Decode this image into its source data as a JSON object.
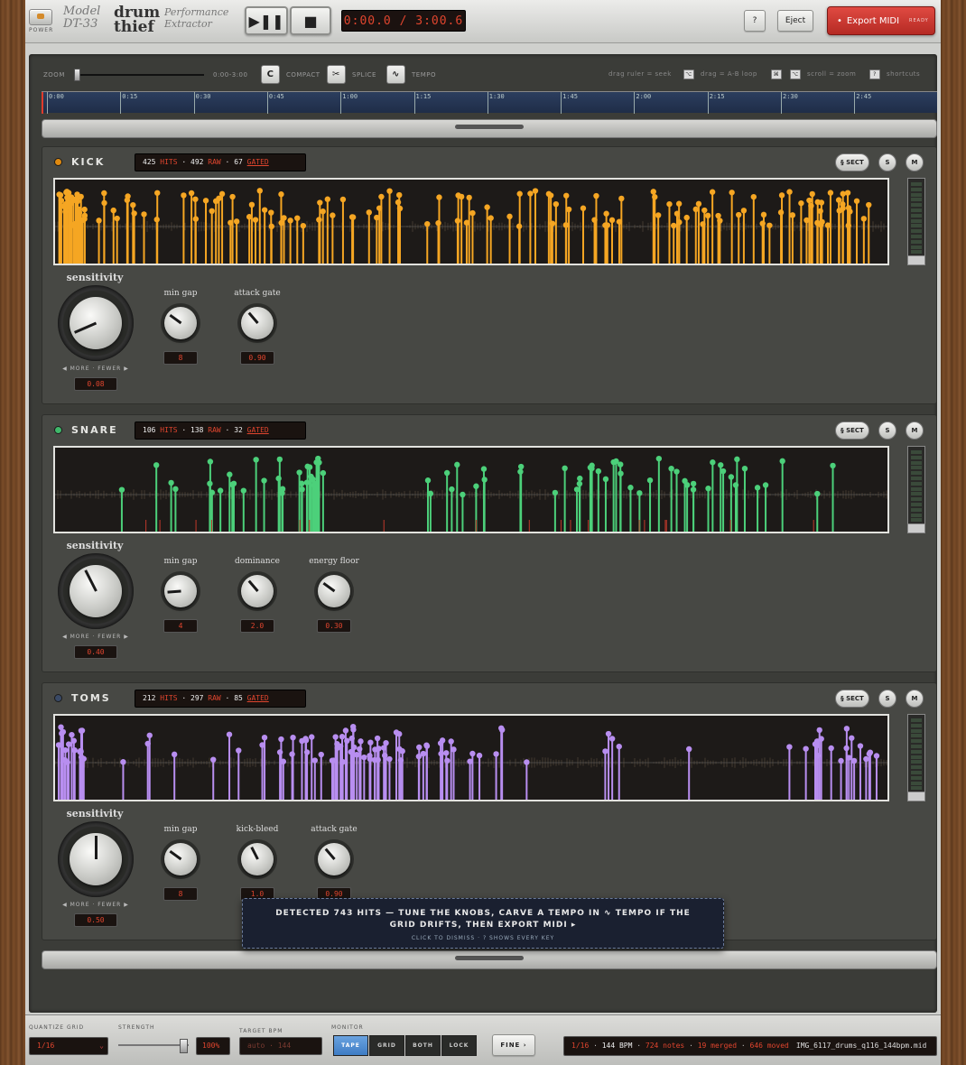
{
  "header": {
    "power_label": "POWER",
    "brand_model_line1": "Model",
    "brand_model_line2": "DT-33",
    "brand_name_line1": "drum",
    "brand_name_line2": "thief",
    "brand_sub_line1": "Performance",
    "brand_sub_line2": "Extractor",
    "time_display": "0:00.0 / 3:00.6",
    "help_label": "?",
    "eject_label": "Eject",
    "export_label": "Export MIDI",
    "export_status": "READY"
  },
  "controls": {
    "zoom_label": "ZOOM",
    "zoom_range": "0:00-3:00",
    "compact_icon_text": "C",
    "compact_label": "COMPACT",
    "splice_label": "SPLICE",
    "tempo_label": "TEMPO",
    "hint_seek": "drag ruler = seek",
    "hint_loop_key": "⌥",
    "hint_loop": "drag = A-B loop",
    "hint_zoom_key1": "⌘",
    "hint_zoom_key2": "⌥",
    "hint_zoom": "scroll = zoom",
    "shortcuts_key": "?",
    "shortcuts_label": "shortcuts"
  },
  "ruler_ticks": [
    "0:00",
    "0:15",
    "0:30",
    "0:45",
    "1:00",
    "1:15",
    "1:30",
    "1:45",
    "2:00",
    "2:15",
    "2:30",
    "2:45"
  ],
  "tracks": [
    {
      "name": "KICK",
      "color": "#f5a623",
      "led_color": "#e08a10",
      "stats": {
        "hits": "425",
        "hits_label": "HITS",
        "raw": "492",
        "raw_label": "RAW",
        "gated": "67",
        "gated_label": "GATED"
      },
      "sect_label": "§ SECT",
      "solo_label": "S",
      "mute_label": "M",
      "sensitivity_label": "sensitivity",
      "more_fewer": "◀ MORE · FEWER ▶",
      "sensitivity_value": "0.08",
      "sensitivity_level": 0.08,
      "knobs": [
        {
          "label": "min gap",
          "value": "8",
          "level": 0.3
        },
        {
          "label": "attack gate",
          "value": "0.90",
          "level": 0.35
        }
      ]
    },
    {
      "name": "SNARE",
      "color": "#4cd07a",
      "led_color": "#3fb86a",
      "stats": {
        "hits": "106",
        "hits_label": "HITS",
        "raw": "138",
        "raw_label": "RAW",
        "gated": "32",
        "gated_label": "GATED"
      },
      "sect_label": "§ SECT",
      "solo_label": "S",
      "mute_label": "M",
      "sensitivity_label": "sensitivity",
      "more_fewer": "◀ MORE · FEWER ▶",
      "sensitivity_value": "0.40",
      "sensitivity_level": 0.4,
      "knobs": [
        {
          "label": "min gap",
          "value": "4",
          "level": 0.15
        },
        {
          "label": "dominance",
          "value": "2.0",
          "level": 0.35
        },
        {
          "label": "energy floor",
          "value": "0.30",
          "level": 0.3
        }
      ]
    },
    {
      "name": "TOMS",
      "color": "#b88ef0",
      "led_color": "#3a4a66",
      "stats": {
        "hits": "212",
        "hits_label": "HITS",
        "raw": "297",
        "raw_label": "RAW",
        "gated": "85",
        "gated_label": "GATED"
      },
      "sect_label": "§ SECT",
      "solo_label": "S",
      "mute_label": "M",
      "sensitivity_label": "sensitivity",
      "more_fewer": "◀ MORE · FEWER ▶",
      "sensitivity_value": "0.50",
      "sensitivity_level": 0.5,
      "knobs": [
        {
          "label": "min gap",
          "value": "8",
          "level": 0.3
        },
        {
          "label": "kick-bleed",
          "value": "1.0",
          "level": 0.4
        },
        {
          "label": "attack gate",
          "value": "0.90",
          "level": 0.35
        }
      ]
    }
  ],
  "toast": {
    "message": "DETECTED 743 HITS — TUNE THE KNOBS, CARVE A TEMPO IN ∿ TEMPO IF THE GRID DRIFTS, THEN EXPORT MIDI ▸",
    "hint": "CLICK TO DISMISS · ? SHOWS EVERY KEY"
  },
  "bottom": {
    "quantize_label": "QUANTIZE GRID",
    "quantize_value": "1/16",
    "strength_label": "STRENGTH",
    "strength_value": "100%",
    "strength_level": 1.0,
    "bpm_label": "TARGET BPM",
    "bpm_placeholder": "auto · 144",
    "monitor_label": "MONITOR",
    "monitor_options": [
      "TAPE",
      "GRID",
      "BOTH",
      "LOCK"
    ],
    "monitor_selected": "TAPE",
    "fine_label": "FINE ›",
    "status": {
      "grid": "1/16",
      "bpm": "144 BPM",
      "notes": "724 notes",
      "merged": "19 merged",
      "moved": "646 moved",
      "file": "IMG_6117_drums_q116_144bpm.mid"
    }
  }
}
